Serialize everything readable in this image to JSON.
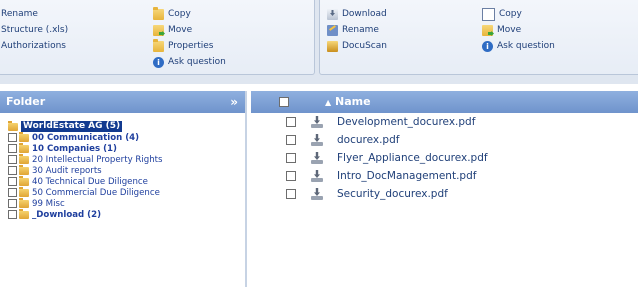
{
  "toolbar": {
    "left_col1": [
      {
        "label": "Rename",
        "icon": "rename-icon"
      },
      {
        "label": "Structure (.xls)",
        "icon": "structure-icon"
      },
      {
        "label": "Authorizations",
        "icon": "authorizations-icon"
      }
    ],
    "left_col2": [
      {
        "label": "Copy",
        "icon": "copy-folder-icon"
      },
      {
        "label": "Move",
        "icon": "move-icon"
      },
      {
        "label": "Properties",
        "icon": "properties-icon"
      },
      {
        "label": "Ask question",
        "icon": "info-icon"
      }
    ],
    "right_col1": [
      {
        "label": "Download",
        "icon": "download-icon"
      },
      {
        "label": "Rename",
        "icon": "rename-icon"
      },
      {
        "label": "DocuScan",
        "icon": "docuscan-icon"
      }
    ],
    "right_col2": [
      {
        "label": "Copy",
        "icon": "copy-icon"
      },
      {
        "label": "Move",
        "icon": "move-icon"
      },
      {
        "label": "Ask question",
        "icon": "info-icon"
      }
    ]
  },
  "folder_pane": {
    "title": "Folder",
    "collapse_glyph": "»",
    "root": "WorldEstate AG (5)",
    "items": [
      {
        "label": "00 Communication (4)",
        "bold": true
      },
      {
        "label": "10 Companies (1)",
        "bold": true
      },
      {
        "label": "20 Intellectual Property Rights",
        "bold": false
      },
      {
        "label": "30 Audit reports",
        "bold": false
      },
      {
        "label": "40 Technical Due Diligence",
        "bold": false
      },
      {
        "label": "50 Commercial Due Diligence",
        "bold": false
      },
      {
        "label": "99 Misc",
        "bold": false
      },
      {
        "label": "_Download (2)",
        "bold": true
      }
    ]
  },
  "file_pane": {
    "column_name": "Name",
    "sort_glyph": "▲",
    "files": [
      "Development_docurex.pdf",
      "docurex.pdf",
      "Flyer_Appliance_docurex.pdf",
      "Intro_DocManagement.pdf",
      "Security_docurex.pdf"
    ]
  }
}
